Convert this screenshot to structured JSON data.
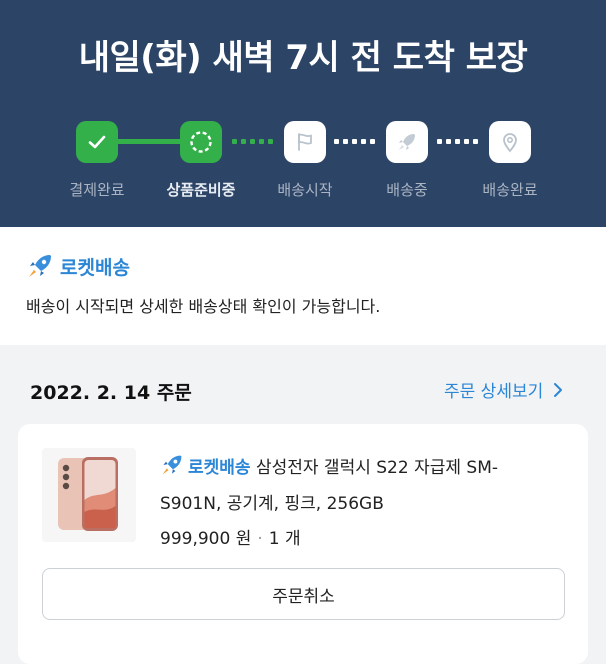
{
  "hero": {
    "title": "내일(화) 새벽 7시 전 도착 보장"
  },
  "steps": [
    {
      "label": "결제완료",
      "status": "done",
      "icon": "check-icon"
    },
    {
      "label": "상품준비중",
      "status": "current",
      "icon": "loading-circle-icon"
    },
    {
      "label": "배송시작",
      "status": "pending",
      "icon": "flag-icon"
    },
    {
      "label": "배송중",
      "status": "pending",
      "icon": "rocket-icon"
    },
    {
      "label": "배송완료",
      "status": "pending",
      "icon": "location-pin-icon"
    }
  ],
  "notice": {
    "brand": "로켓배송",
    "text": "배송이 시작되면 상세한 배송상태 확인이 가능합니다."
  },
  "order": {
    "date": "2022. 2. 14 주문",
    "detail_link": "주문 상세보기",
    "item": {
      "badge": "로켓배송",
      "name": "삼성전자 갤럭시 S22 자급제 SM-S901N, 공기계, 핑크, 256GB",
      "price": "999,900 원",
      "separator": "·",
      "quantity": "1 개"
    },
    "cancel_label": "주문취소"
  },
  "colors": {
    "header_bg": "#2c4466",
    "done_green": "#34b04a",
    "accent_blue": "#2b86d6"
  }
}
